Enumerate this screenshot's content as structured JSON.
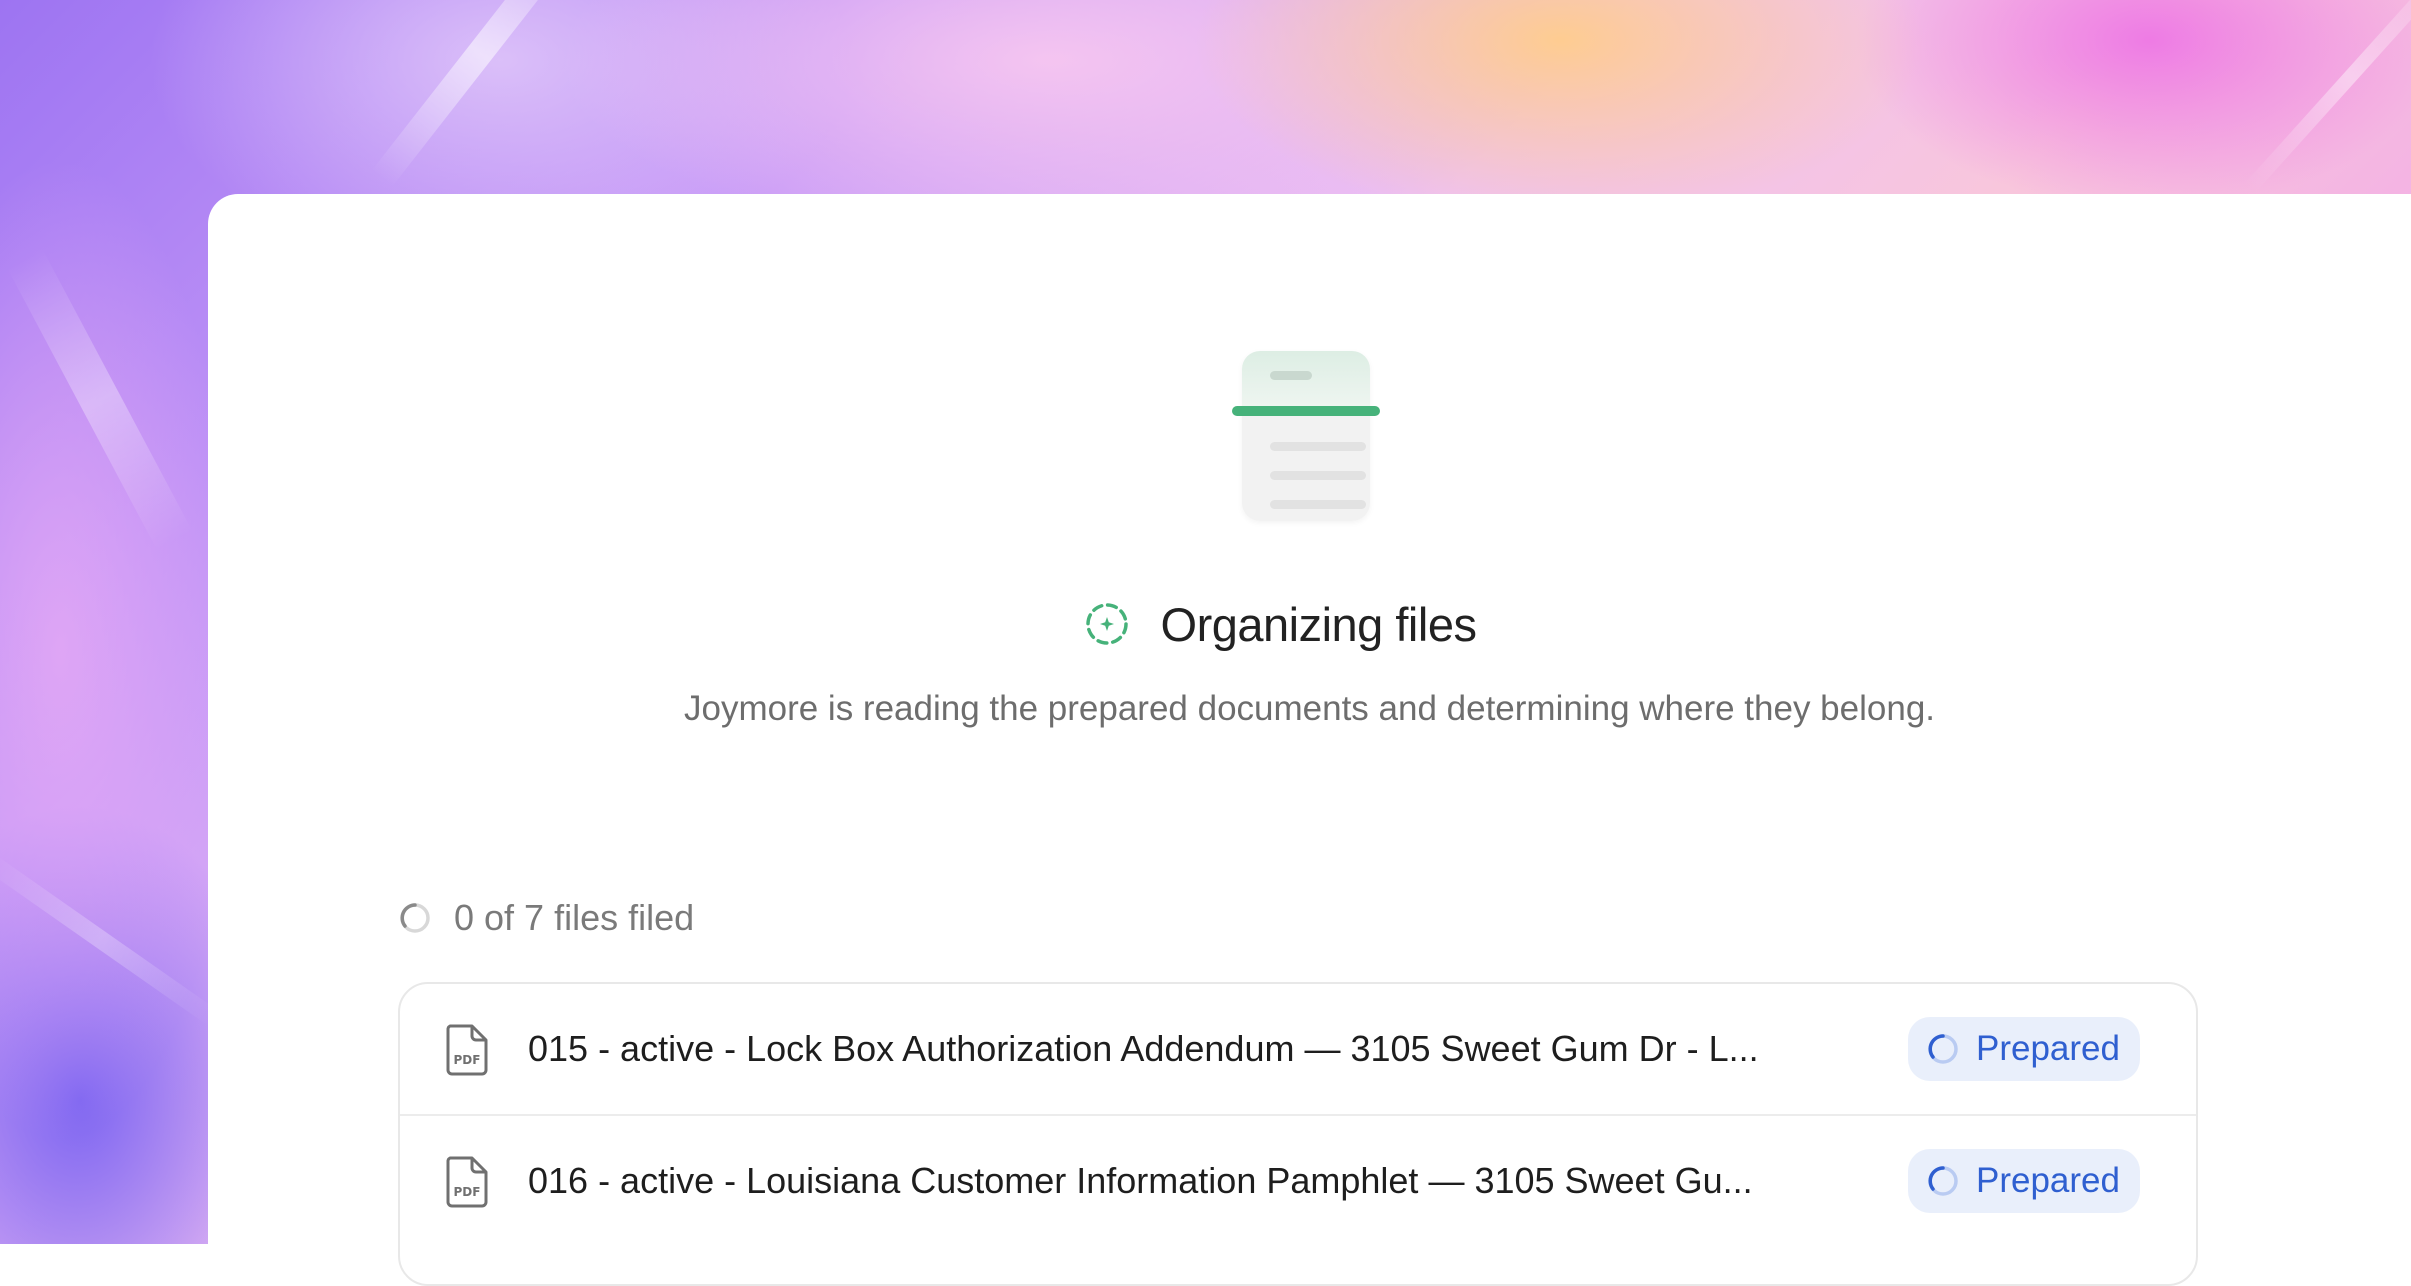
{
  "page": {
    "title": "Organizing files",
    "subtitle": "Joymore is reading the prepared documents and determining where they belong."
  },
  "progress": {
    "text": "0 of 7 files filed",
    "filed": 0,
    "total": 7
  },
  "files": [
    {
      "name": "015 - active - Lock Box Authorization Addendum — 3105 Sweet Gum Dr - L...",
      "status": "Prepared",
      "icon": "pdf-file-icon"
    },
    {
      "name": "016 - active - Louisiana Customer Information Pamphlet — 3105 Sweet Gu...",
      "status": "Prepared",
      "icon": "pdf-file-icon"
    }
  ],
  "colors": {
    "accent_green": "#46b27a",
    "status_blue": "#2f5fd0",
    "status_pill_bg": "#e9effb",
    "title_text": "#222222",
    "muted_text": "#6d6d6d"
  }
}
